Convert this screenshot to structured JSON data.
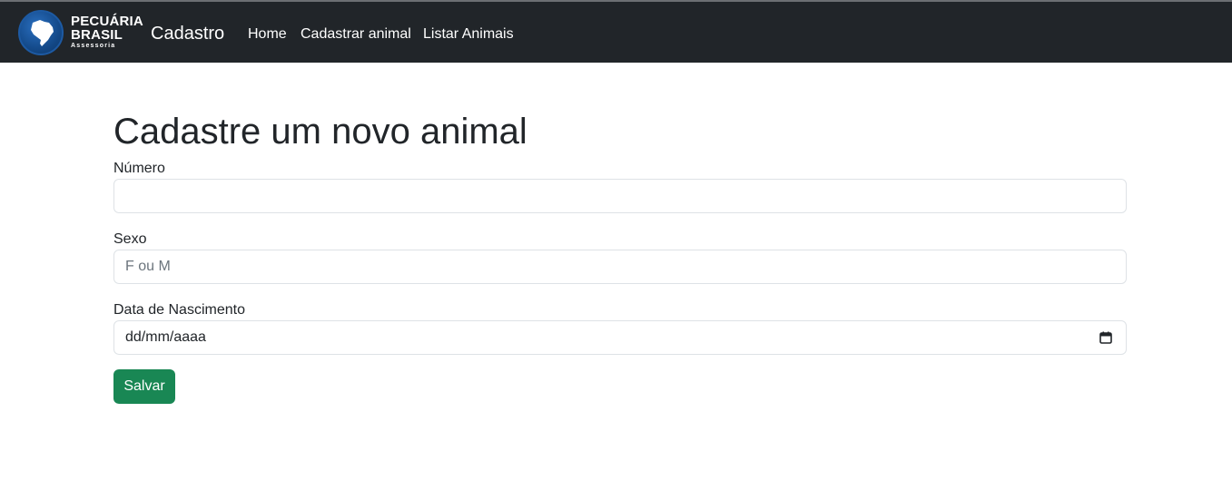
{
  "navbar": {
    "logo": {
      "line1": "PECUÁRIA",
      "line2": "BRASIL",
      "sub": "Assessoria"
    },
    "brand": "Cadastro",
    "links": [
      {
        "label": "Home"
      },
      {
        "label": "Cadastrar animal"
      },
      {
        "label": "Listar Animais"
      }
    ]
  },
  "main": {
    "title": "Cadastre um novo animal",
    "fields": [
      {
        "label": "Número",
        "value": "",
        "placeholder": ""
      },
      {
        "label": "Sexo",
        "value": "",
        "placeholder": "F ou M"
      },
      {
        "label": "Data de Nascimento",
        "value": "dd/mm/aaaa",
        "placeholder": "",
        "icon": "calendar-icon"
      }
    ],
    "submit_label": "Salvar"
  },
  "colors": {
    "navbar_bg": "#212529",
    "button_bg": "#198754",
    "logo_blue": "#144a8a"
  }
}
